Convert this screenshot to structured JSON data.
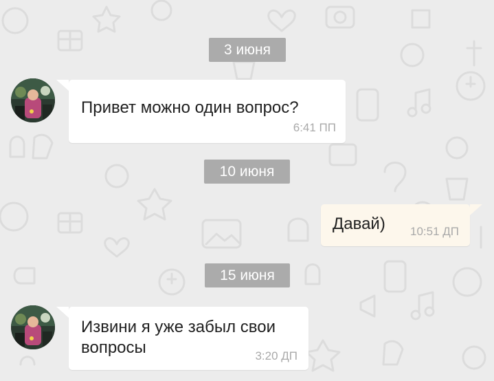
{
  "background": {
    "color": "#ececec",
    "pattern": "doodle-icons"
  },
  "messages": [
    {
      "date": "3 июня",
      "direction": "incoming",
      "text_lines": [
        "Привет можно один вопрос?"
      ],
      "time": "6:41 ПП"
    },
    {
      "date": "10 июня",
      "direction": "outgoing",
      "text_lines": [
        "Давай)"
      ],
      "time": "10:51 ДП"
    },
    {
      "date": "15 июня",
      "direction": "incoming",
      "text_lines": [
        "Извини я уже забыл свои",
        "вопросы"
      ],
      "time": "3:20 ДП"
    }
  ],
  "colors": {
    "date_badge_bg": "#ababab",
    "incoming_bubble": "#ffffff",
    "outgoing_bubble": "#fdf7ec",
    "time_text": "#a9a9a9",
    "message_text": "#202020"
  }
}
